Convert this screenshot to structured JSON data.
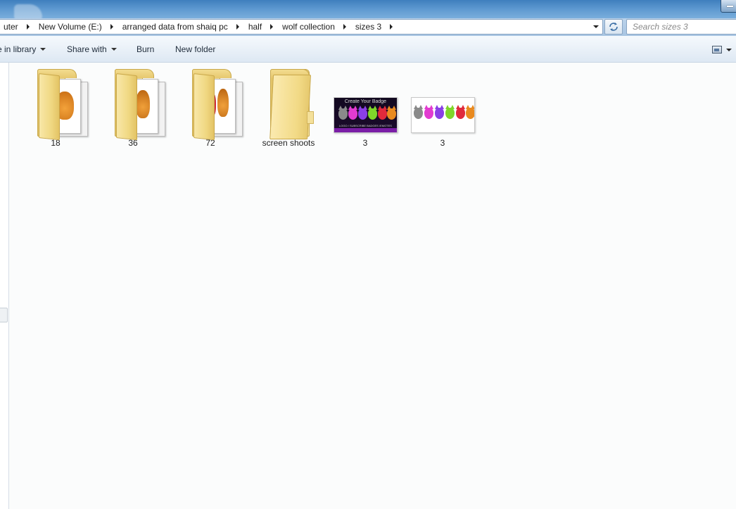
{
  "breadcrumb": [
    "uter",
    "New Volume (E:)",
    "arranged data from shaiq pc",
    "half",
    "wolf collection",
    "sizes 3"
  ],
  "search": {
    "placeholder": "Search sizes 3"
  },
  "toolbar": {
    "include_label": "e in library",
    "share_label": "Share with",
    "burn_label": "Burn",
    "new_folder_label": "New folder"
  },
  "items": [
    {
      "label": "18",
      "kind": "folder"
    },
    {
      "label": "36",
      "kind": "folder"
    },
    {
      "label": "72",
      "kind": "folder"
    },
    {
      "label": "screen shoots",
      "kind": "folder"
    },
    {
      "label": "3",
      "kind": "image"
    },
    {
      "label": "3",
      "kind": "image"
    }
  ],
  "thumb1": {
    "title": "Create Your Badge",
    "caption": "LOGO / SUBSCRIBE BADGES /EMOTES"
  },
  "colors": {
    "wolf_gray": "#8a8a8a",
    "wolf_pink": "#e23bd0",
    "wolf_purple": "#8a3fe6",
    "wolf_green": "#7fd62a",
    "wolf_red": "#e02a3c",
    "wolf_orange": "#e98a1f",
    "folder_yellow": "#f2d882"
  }
}
